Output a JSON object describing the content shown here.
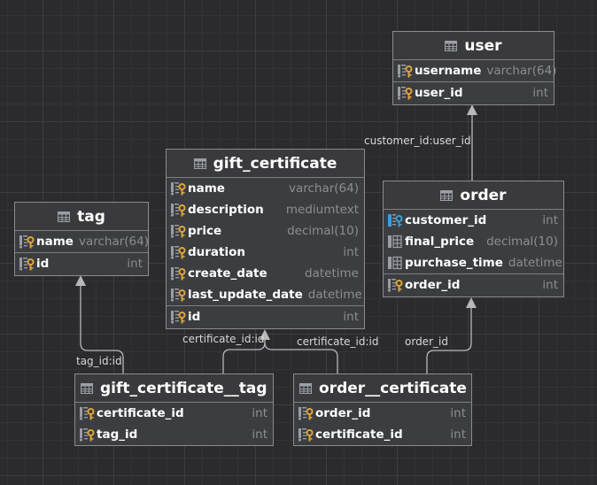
{
  "diagram": {
    "colors": {
      "canvas": "#2b2a2d",
      "table_border": "#8b8b8b",
      "edge": "#b8b8b8",
      "key_icon": "#e0a43a",
      "fk_icon": "#3aa0d8",
      "column_name": "#ffffff",
      "column_type": "#8c8d90"
    },
    "tables": {
      "user": {
        "title": "user",
        "columns": [
          {
            "name": "username",
            "type": "varchar(64)",
            "icon": "key-column-icon"
          },
          {
            "name": "user_id",
            "type": "int",
            "icon": "key-column-icon"
          }
        ]
      },
      "gift_certificate": {
        "title": "gift_certificate",
        "columns": [
          {
            "name": "name",
            "type": "varchar(64)",
            "icon": "key-column-icon"
          },
          {
            "name": "description",
            "type": "mediumtext",
            "icon": "key-column-icon"
          },
          {
            "name": "price",
            "type": "decimal(10)",
            "icon": "key-column-icon"
          },
          {
            "name": "duration",
            "type": "int",
            "icon": "key-column-icon"
          },
          {
            "name": "create_date",
            "type": "datetime",
            "icon": "key-column-icon"
          },
          {
            "name": "last_update_date",
            "type": "datetime",
            "icon": "key-column-icon"
          },
          {
            "name": "id",
            "type": "int",
            "icon": "key-column-icon"
          }
        ]
      },
      "tag": {
        "title": "tag",
        "columns": [
          {
            "name": "name",
            "type": "varchar(64)",
            "icon": "key-column-icon"
          },
          {
            "name": "id",
            "type": "int",
            "icon": "key-column-icon"
          }
        ]
      },
      "order": {
        "title": "order",
        "columns": [
          {
            "name": "customer_id",
            "type": "int",
            "icon": "foreign-key-column-icon"
          },
          {
            "name": "final_price",
            "type": "decimal(10)",
            "icon": "column-icon"
          },
          {
            "name": "purchase_time",
            "type": "datetime",
            "icon": "column-icon"
          },
          {
            "name": "order_id",
            "type": "int",
            "icon": "key-column-icon"
          }
        ]
      },
      "gift_certificate__tag": {
        "title": "gift_certificate__tag",
        "columns": [
          {
            "name": "certificate_id",
            "type": "int",
            "icon": "key-column-icon"
          },
          {
            "name": "tag_id",
            "type": "int",
            "icon": "key-column-icon"
          }
        ]
      },
      "order__certificate": {
        "title": "order__certificate",
        "columns": [
          {
            "name": "order_id",
            "type": "int",
            "icon": "key-column-icon"
          },
          {
            "name": "certificate_id",
            "type": "int",
            "icon": "key-column-icon"
          }
        ]
      }
    },
    "relations": [
      {
        "from": "order",
        "to": "user",
        "label": "customer_id:user_id"
      },
      {
        "from": "gift_certificate__tag",
        "to": "tag",
        "label": "tag_id:id"
      },
      {
        "from": "gift_certificate__tag",
        "to": "gift_certificate",
        "label": "certificate_id:id"
      },
      {
        "from": "order__certificate",
        "to": "gift_certificate",
        "label": "certificate_id:id"
      },
      {
        "from": "order__certificate",
        "to": "order",
        "label": "order_id"
      }
    ]
  }
}
